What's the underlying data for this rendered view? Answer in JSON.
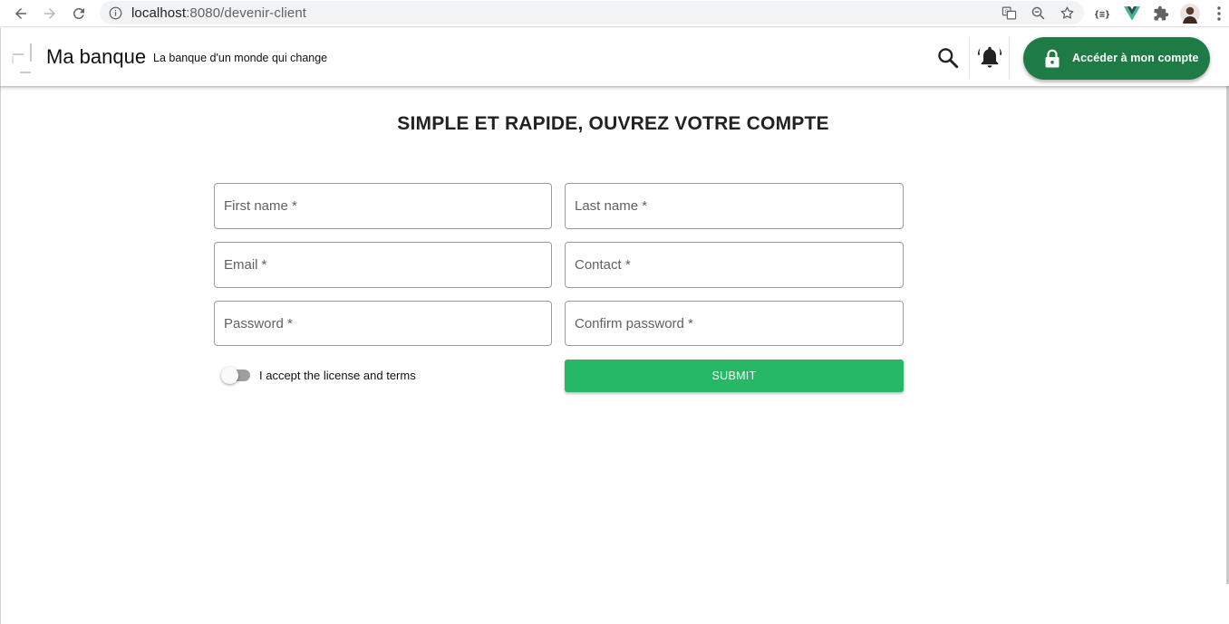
{
  "browser": {
    "url_host": "localhost",
    "url_path": ":8080/devenir-client"
  },
  "header": {
    "brand_name": "Ma banque",
    "tagline": "La banque d'un monde qui change",
    "account_button_label": "Accéder à mon compte"
  },
  "form": {
    "title": "SIMPLE ET RAPIDE, OUVREZ VOTRE COMPTE",
    "first_name_placeholder": "First name *",
    "last_name_placeholder": "Last name *",
    "email_placeholder": "Email *",
    "contact_placeholder": "Contact *",
    "password_placeholder": "Password *",
    "confirm_password_placeholder": "Confirm password *",
    "terms_label": "I accept the license and terms",
    "terms_accepted": false,
    "submit_label": "SUBMIT"
  },
  "colors": {
    "account_button": "#1e7b46",
    "submit_button": "#26b865"
  },
  "icons": {
    "header_search": "search-icon",
    "header_notifications": "bell-icon",
    "account_lock": "lock-icon"
  }
}
